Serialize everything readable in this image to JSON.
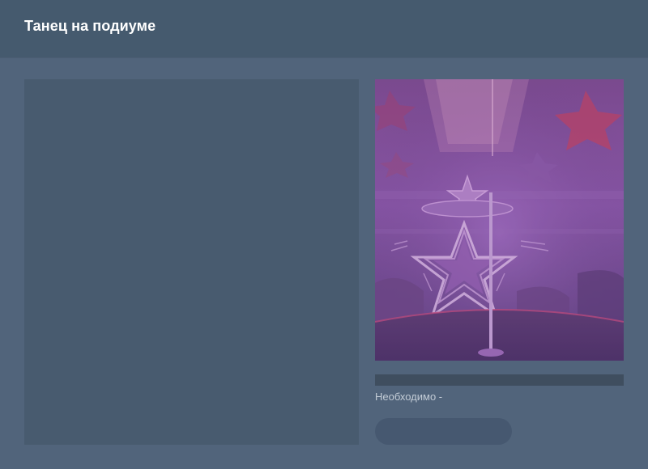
{
  "header": {
    "title": "Танец на подиуме"
  },
  "scene": {
    "image_name": "club-stage-stars-illustration"
  },
  "details": {
    "requirement_label": "Необходимо -",
    "action_button_label": ""
  },
  "colors": {
    "background": "#51647b",
    "header": "#455a6e",
    "panel": "#485b6f",
    "progress_bar": "#3f4e5f",
    "button": "#465870",
    "scene_tint": "#7a4a9a"
  }
}
